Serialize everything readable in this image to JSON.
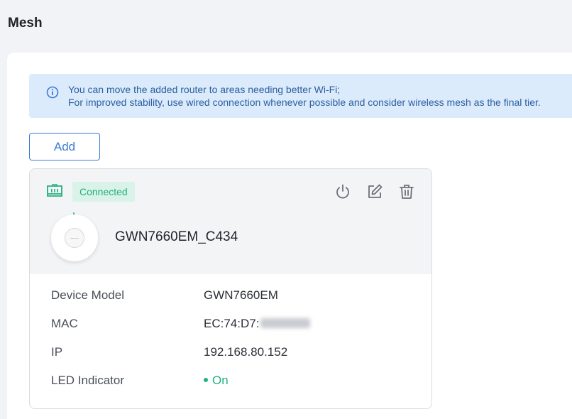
{
  "page": {
    "title": "Mesh"
  },
  "banner": {
    "line1": "You can move the added router to areas needing better Wi-Fi;",
    "line2": "For improved stability, use wired connection whenever possible and consider wireless mesh as the final tier.",
    "icon": "info-icon"
  },
  "actions": {
    "add_label": "Add"
  },
  "device": {
    "status": "Connected",
    "name": "GWN7660EM_C434",
    "icons": [
      "ethernet-icon",
      "power-icon",
      "edit-icon",
      "delete-icon"
    ],
    "details": {
      "model_label": "Device Model",
      "model_value": "GWN7660EM",
      "mac_label": "MAC",
      "mac_value": "EC:74:D7:",
      "ip_label": "IP",
      "ip_value": "192.168.80.152",
      "led_label": "LED Indicator",
      "led_value": "On"
    }
  },
  "colors": {
    "accent": "#3a7bd5",
    "status_green": "#22b07d",
    "banner_bg": "#dcebfb"
  }
}
